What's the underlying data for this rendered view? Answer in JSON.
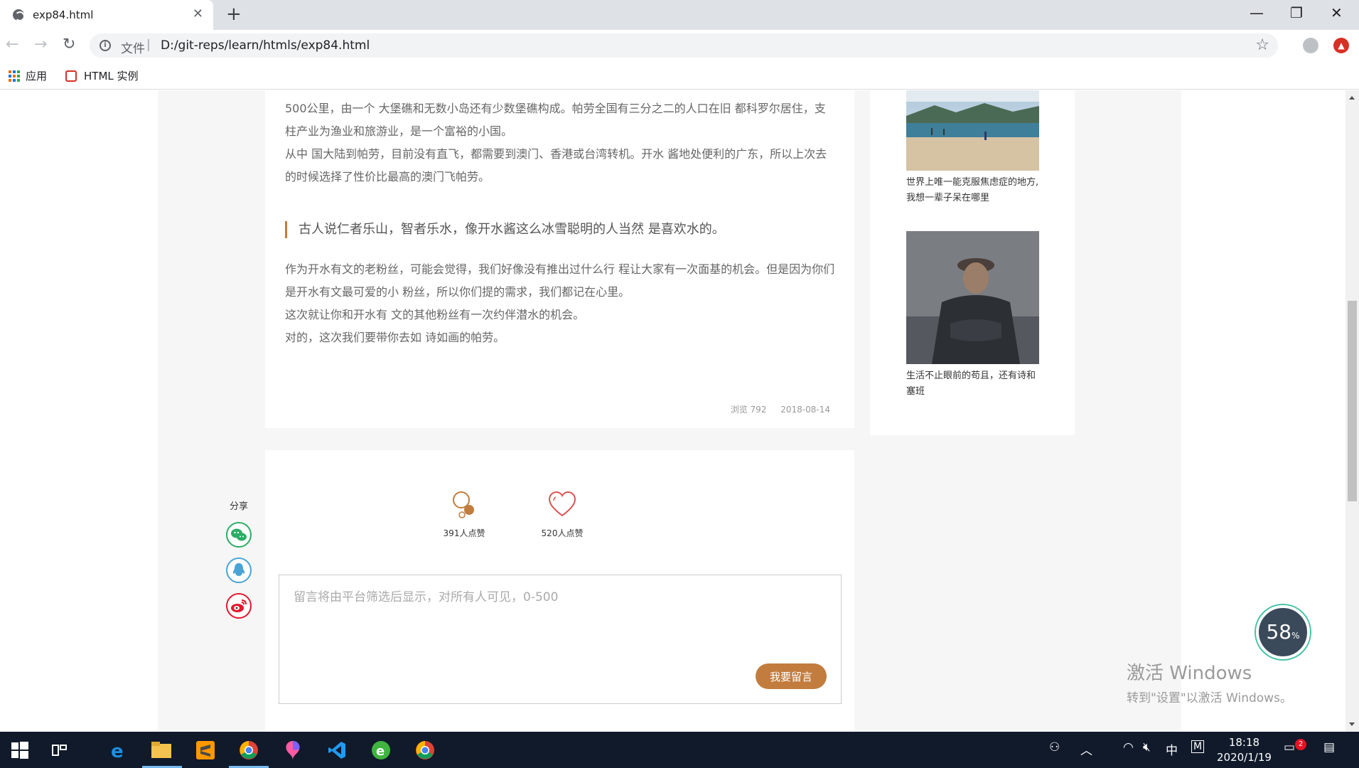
{
  "browser": {
    "tab_title": "exp84.html",
    "tab_close": "✕",
    "new_tab": "+",
    "window_controls": {
      "minimize": "—",
      "restore": "❐",
      "close": "✕"
    },
    "nav": {
      "back": "←",
      "forward": "→",
      "reload": "↻"
    },
    "address": {
      "scheme_label": "文件",
      "separator": "|",
      "url": "D:/git-reps/learn/htmls/exp84.html"
    },
    "bookmark_star": "☆",
    "bookmarks": [
      {
        "label": "应用",
        "icon": "apps-grid-icon"
      },
      {
        "label": "HTML 实例",
        "icon": "html-icon"
      }
    ]
  },
  "article": {
    "paragraphs_top": [
      "500公里，由一个 大堡礁和无数小岛还有少数堡礁构成。帕劳全国有三分之二的人口在旧 都科罗尔居住，支柱产业为渔业和旅游业，是一个富裕的小国。",
      "从中 国大陆到帕劳，目前没有直飞，都需要到澳门、香港或台湾转机。开水 酱地处便利的广东，所以上次去的时候选择了性价比最高的澳门飞帕劳。"
    ],
    "quote": "古人说仁者乐山，智者乐水，像开水酱这么冰雪聪明的人当然 是喜欢水的。",
    "paragraphs_bottom": [
      "作为开水有文的老粉丝，可能会觉得，我们好像没有推出过什么行 程让大家有一次面基的机会。但是因为你们是开水有文最可爱的小 粉丝，所以你们提的需求，我们都记在心里。",
      "这次就让你和开水有 文的其他粉丝有一次约伴潜水的机会。",
      "对的，这次我们要带你去如 诗如画的帕劳。"
    ],
    "views_label": "浏览 792",
    "date": "2018-08-14"
  },
  "sidebar": {
    "items": [
      {
        "caption": "世界上唯一能克服焦虑症的地方,我想一辈子呆在哪里"
      },
      {
        "caption": "生活不止眼前的苟且，还有诗和塞班"
      }
    ]
  },
  "share": {
    "label": "分享",
    "icons": [
      "wechat-icon",
      "qq-icon",
      "weibo-icon"
    ]
  },
  "likes": {
    "first_count": "391人点赞",
    "second_count": "520人点赞"
  },
  "comment": {
    "placeholder": "留言将由平台筛选后显示，对所有人可见，0-500",
    "submit_label": "我要留言"
  },
  "overlay": {
    "gauge_value": "58",
    "gauge_unit": "%",
    "watermark_line1": "激活 Windows",
    "watermark_line2": "转到\"设置\"以激活 Windows。"
  },
  "taskbar": {
    "time": "18:18",
    "date": "2020/1/19",
    "ime": "中",
    "ime_mode": "M",
    "notification_count": "2"
  },
  "colors": {
    "accent": "#c27c3e",
    "wechat": "#2aae67",
    "qq": "#4aa3d6",
    "weibo": "#e6162d"
  }
}
